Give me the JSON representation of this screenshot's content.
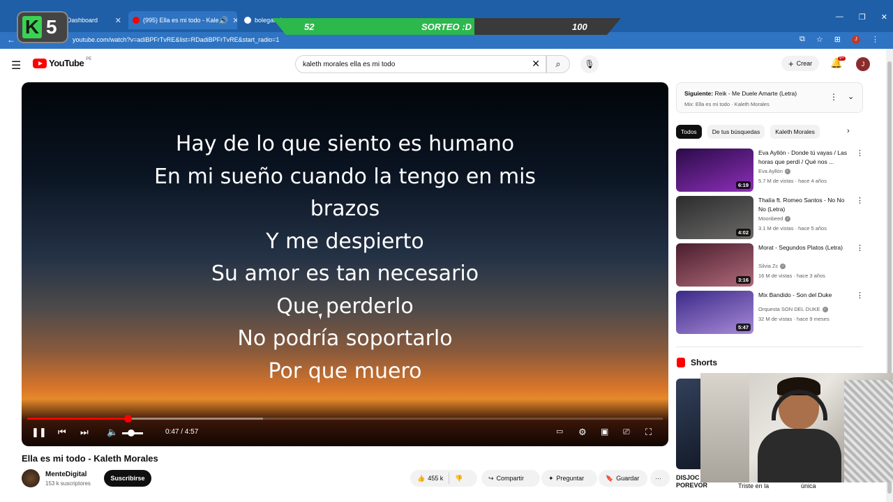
{
  "browser": {
    "tabs": [
      {
        "label": "Dashboard"
      },
      {
        "label": "(995) Ella es mi todo - Kale"
      },
      {
        "label": "bolegancho or"
      }
    ],
    "url": "youtube.com/watch?v=adiBPFrTvRE&list=RDadiBPFrTvRE&start_radio=1",
    "profile_initial": "J"
  },
  "overlay": {
    "badge_number": "5",
    "score_left": "52",
    "score_center": "SORTEO :D",
    "score_right": "100"
  },
  "header": {
    "logo_text": "YouTube",
    "country": "PE",
    "search_value": "kaleth morales ella es mi todo",
    "create_label": "Crear",
    "notif_count": "9+",
    "avatar_initial": "J"
  },
  "player": {
    "lyrics": [
      "Hay de lo que siento es humano",
      "En mi sueño cuando la tengo en mis",
      "brazos",
      "Y me despierto",
      "Su amor es tan necesario",
      "Que perderlo",
      "No podría soportarlo",
      "Por que muero"
    ],
    "time": "0:47 / 4:57",
    "progress": 0.158
  },
  "video": {
    "title": "Ella es mi todo - Kaleth Morales",
    "channel": "MenteDigital",
    "subscribers": "153 k suscriptores",
    "subscribe_label": "Suscribirse",
    "likes": "455 k",
    "share_label": "Compartir",
    "ask_label": "Preguntar",
    "save_label": "Guardar"
  },
  "sidebar": {
    "next_prefix": "Siguiente:",
    "next_title": "Reik - Me Duele Amarte (Letra)",
    "mix_label": "Mix: Ella es mi todo · Kaleth Morales",
    "chips": [
      "Todos",
      "De tus búsquedas",
      "Kaleth Morales"
    ],
    "recs": [
      {
        "title": "Eva Ayllón - Donde tú vayas / Las horas que perdí / Qué nos ...",
        "channel": "Eva Ayllón",
        "meta": "5.7 M de vistas · hace 4 años",
        "duration": "6:19",
        "colors": [
          "#2a0b48",
          "#8d2fb8"
        ]
      },
      {
        "title": "Thalía ft. Romeo Santos - No No No (Letra)",
        "channel": "Moonbeed",
        "meta": "3.1 M de vistas · hace 5 años",
        "duration": "4:02",
        "colors": [
          "#2c2c2e",
          "#6b6a68"
        ]
      },
      {
        "title": "Morat - Segundos Platos (Letra)",
        "channel": "Silvia Zc",
        "meta": "16 M de vistas · hace 3 años",
        "duration": "3:16",
        "colors": [
          "#4a1e2e",
          "#b06a7a"
        ]
      },
      {
        "title": "Mix Bandido - Son del Duke",
        "channel": "Orquesta SON DEL DUKE",
        "meta": "32 M de vistas · hace 9 meses",
        "duration": "5:47",
        "colors": [
          "#3b2a88",
          "#a98ad8"
        ]
      }
    ],
    "shorts_label": "Shorts",
    "short_caption_1": "DISJOC\nPOREVOR",
    "short_caption_2": "Triste en la",
    "short_caption_3": "única"
  }
}
